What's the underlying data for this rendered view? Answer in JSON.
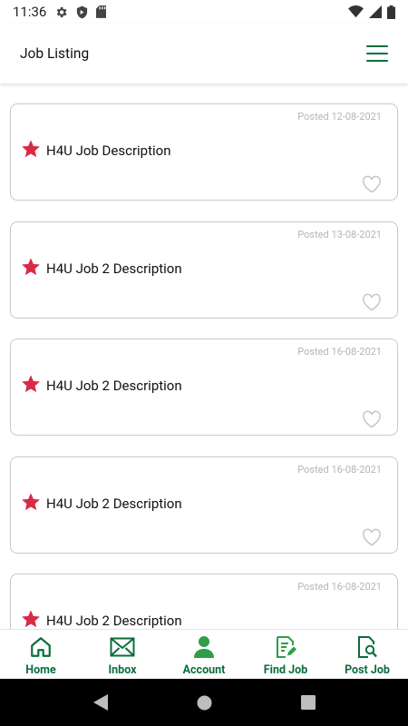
{
  "status_bar": {
    "time": "11:36",
    "icons": [
      "gear-icon",
      "shield-icon",
      "sd-card-icon",
      "wifi-icon",
      "signal-icon",
      "battery-icon"
    ]
  },
  "header": {
    "title": "Job Listing",
    "menu_icon": "hamburger-menu-icon"
  },
  "jobs": [
    {
      "posted": "Posted 12-08-2021",
      "title": "H4U Job Description"
    },
    {
      "posted": "Posted 13-08-2021",
      "title": "H4U Job 2 Description"
    },
    {
      "posted": "Posted 16-08-2021",
      "title": "H4U Job 2 Description"
    },
    {
      "posted": "Posted 16-08-2021",
      "title": "H4U Job 2 Description"
    },
    {
      "posted": "Posted 16-08-2021",
      "title": "H4U Job 2 Description"
    }
  ],
  "bottom_nav": {
    "items": [
      {
        "label": "Home",
        "icon": "home-icon"
      },
      {
        "label": "Inbox",
        "icon": "mail-icon"
      },
      {
        "label": "Account",
        "icon": "person-icon"
      },
      {
        "label": "Find Job",
        "icon": "edit-document-icon"
      },
      {
        "label": "Post Job",
        "icon": "search-document-icon"
      }
    ]
  },
  "colors": {
    "accent": "#0a6e3a",
    "star": "#d92b45",
    "date_text": "#b5b5b5",
    "card_border": "#c9c9c9"
  }
}
